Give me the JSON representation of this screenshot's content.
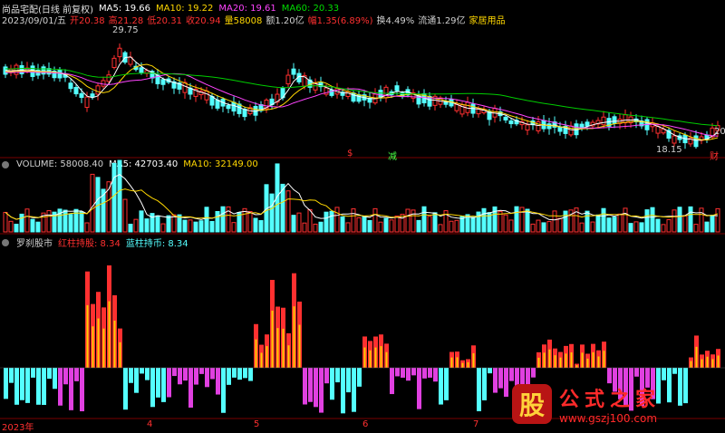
{
  "header": {
    "line1": {
      "stock": "尚品宅配(日线 前复权)",
      "ma5": "MA5: 19.66",
      "ma10": "MA10: 19.22",
      "ma20": "MA20: 19.61",
      "ma60": "MA60: 20.33"
    },
    "line2": {
      "date": "2023/09/01/五",
      "open": "开20.38",
      "high": "高21.28",
      "low": "低20.31",
      "close": "收20.94",
      "vol": "量58008",
      "amt": "额1.20亿",
      "chg": "幅1.35(6.89%)",
      "turn": "换4.49%",
      "float": "流通1.29亿",
      "industry": "家居用品"
    },
    "high_marker": "29.75",
    "low_marker": "18.15",
    "right_label": "20",
    "event_labels": [
      "$",
      "减",
      "财"
    ]
  },
  "volume_panel": {
    "title": "VOLUME: 58008.40",
    "ma5": "MA5: 42703.40",
    "ma10": "MA10: 32149.00"
  },
  "indicator_panel": {
    "title": "罗刹股市",
    "red_label": "红柱持股: 8.34",
    "cyan_label": "蓝柱持币: 8.34"
  },
  "xaxis": {
    "year": "2023年",
    "months": [
      "4",
      "5",
      "6",
      "7"
    ]
  },
  "watermark": {
    "badge": "股",
    "title": "公式之家",
    "url": "www.gszj100.com"
  },
  "colors": {
    "up": "#ff3030",
    "down": "#54ffff",
    "ma5": "#ffffff",
    "ma10": "#ffd700",
    "ma20": "#ff44ff",
    "ma60": "#00cc00",
    "magenta_bar": "#e040e0",
    "yellow_bar": "#ffcc00"
  }
}
